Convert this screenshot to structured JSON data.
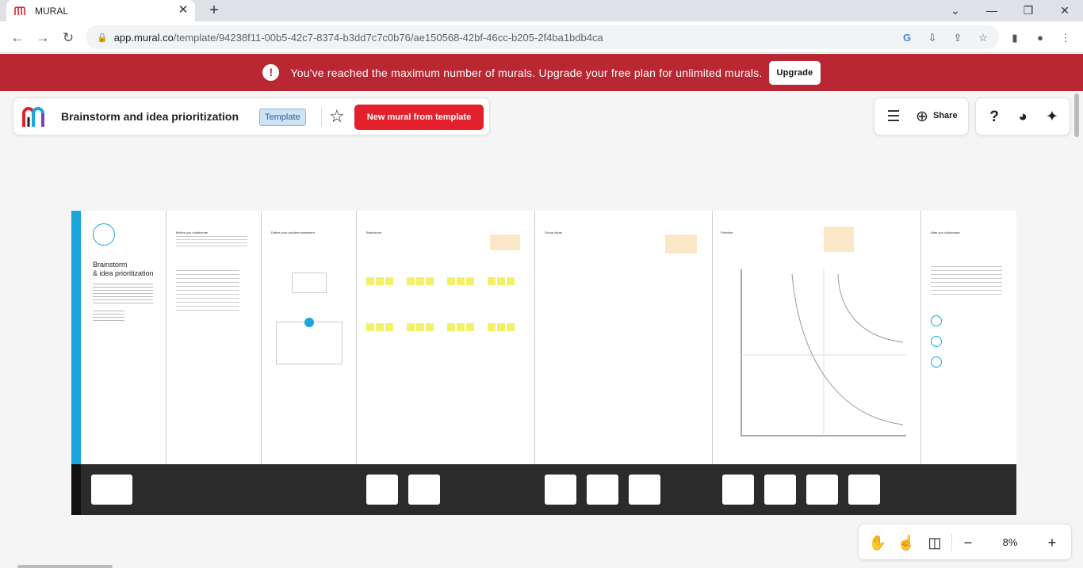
{
  "browser": {
    "tab_title": "MURAL",
    "url_host": "app.mural.co",
    "url_path": "/template/94238f11-00b5-42c7-8374-b3dd7c7c0b76/ae150568-42bf-46cc-b205-2f4ba1bdb4ca"
  },
  "banner": {
    "message": "You've reached the maximum number of murals. Upgrade your free plan for unlimited murals.",
    "upgrade_label": "Upgrade"
  },
  "header": {
    "title": "Brainstorm and idea prioritization",
    "badge": "Template",
    "new_mural_label": "New mural from template",
    "share_label": "Share"
  },
  "board": {
    "intro_title_line1": "Brainstorm",
    "intro_title_line2": "& idea prioritization",
    "sections": [
      "Before you collaborate",
      "Define your problem statement",
      "Brainstorm",
      "Group ideas",
      "Prioritize",
      "After you collaborate"
    ]
  },
  "zoom": {
    "level": "8%"
  },
  "colors": {
    "banner": "#b92733",
    "primary_button": "#e3202c",
    "sticky": "#f5f06a",
    "board_accent": "#1aa6dd"
  }
}
